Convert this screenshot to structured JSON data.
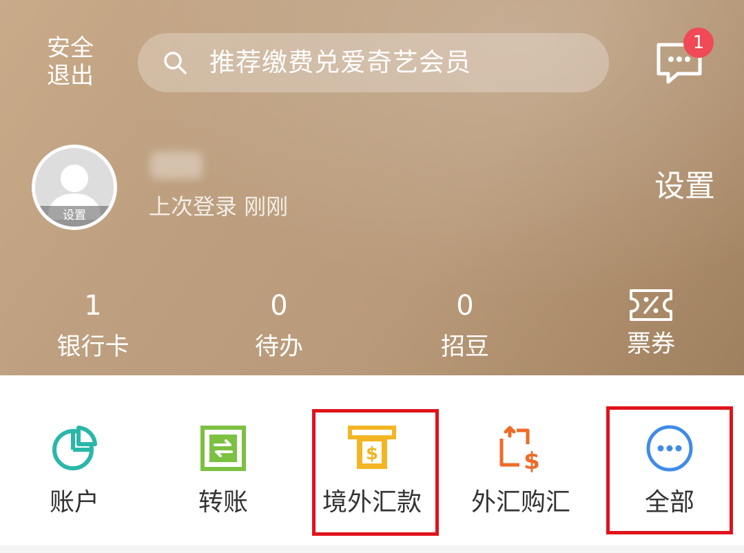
{
  "header": {
    "logout_line1": "安全",
    "logout_line2": "退出",
    "search_placeholder": "推荐缴费兑爱奇艺会员",
    "message_badge": "1"
  },
  "profile": {
    "avatar_label": "设置",
    "last_login": "上次登录 刚刚",
    "settings_label": "设置"
  },
  "stats": [
    {
      "value": "1",
      "label": "银行卡"
    },
    {
      "value": "0",
      "label": "待办"
    },
    {
      "value": "0",
      "label": "招豆"
    },
    {
      "icon": "ticket-icon",
      "label": "票券"
    }
  ],
  "quick_actions": [
    {
      "icon": "account-pie-icon",
      "label": "账户"
    },
    {
      "icon": "transfer-icon",
      "label": "转账"
    },
    {
      "icon": "overseas-remittance-icon",
      "label": "境外汇款",
      "highlighted": true
    },
    {
      "icon": "forex-exchange-icon",
      "label": "外汇购汇"
    },
    {
      "icon": "more-icon",
      "label": "全部",
      "highlighted": true
    }
  ],
  "colors": {
    "hero_background": "#bea080",
    "badge": "#ef4a55",
    "highlight_border": "#e0131b",
    "account_icon": "#2ab7a9",
    "transfer_icon": "#7cc142",
    "remittance_icon": "#f3b523",
    "forex_icon": "#ef6a2a",
    "more_icon": "#3f8ce8"
  }
}
